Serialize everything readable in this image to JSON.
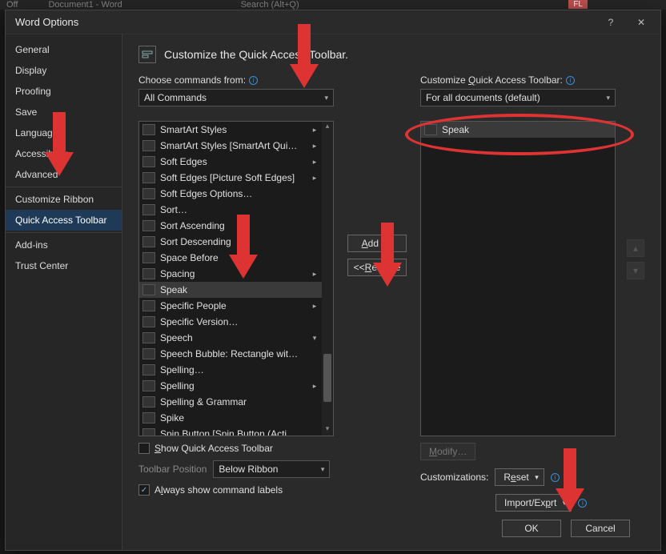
{
  "bg": {
    "off": "Off",
    "doc_title": "Document1 - Word",
    "search_placeholder": "Search (Alt+Q)",
    "user_badge": "FL"
  },
  "dialog": {
    "title": "Word Options",
    "header": "Customize the Quick Access Toolbar.",
    "nav": [
      "General",
      "Display",
      "Proofing",
      "Save",
      "Language",
      "Accessibility",
      "Advanced",
      "Customize Ribbon",
      "Quick Access Toolbar",
      "Add-ins",
      "Trust Center"
    ],
    "nav_selected_index": 8,
    "choose_label": "Choose commands from:",
    "choose_value": "All Commands",
    "customize_label": "Customize Quick Access Toolbar:",
    "customize_value": "For all documents (default)",
    "commands": [
      {
        "label": "SmartArt Styles",
        "sub": true
      },
      {
        "label": "SmartArt Styles [SmartArt Qui…",
        "sub": true
      },
      {
        "label": "Soft Edges",
        "sub": true
      },
      {
        "label": "Soft Edges [Picture Soft Edges]",
        "sub": true
      },
      {
        "label": "Soft Edges Options…"
      },
      {
        "label": "Sort…"
      },
      {
        "label": "Sort Ascending"
      },
      {
        "label": "Sort Descending"
      },
      {
        "label": "Space Before"
      },
      {
        "label": "Spacing",
        "sub": true
      },
      {
        "label": "Speak",
        "selected": true
      },
      {
        "label": "Specific People",
        "sub": true
      },
      {
        "label": "Specific Version…"
      },
      {
        "label": "Speech",
        "drop": true
      },
      {
        "label": "Speech Bubble: Rectangle wit…"
      },
      {
        "label": "Spelling…"
      },
      {
        "label": "Spelling",
        "sub": true
      },
      {
        "label": "Spelling & Grammar"
      },
      {
        "label": "Spike"
      },
      {
        "label": "Spin Button [Spin Button (Acti…"
      }
    ],
    "qat_items": [
      {
        "label": "Speak"
      }
    ],
    "add_btn": "Add >>",
    "remove_btn": "<< Remove",
    "show_qat_label": "Show Quick Access Toolbar",
    "show_qat_checked": false,
    "toolbar_position_label": "Toolbar Position",
    "toolbar_position_value": "Below Ribbon",
    "always_labels_label": "Always show command labels",
    "always_labels_checked": true,
    "modify_btn": "Modify…",
    "customizations_label": "Customizations:",
    "reset_btn": "Reset",
    "import_export_btn": "Import/Export",
    "ok": "OK",
    "cancel": "Cancel"
  }
}
